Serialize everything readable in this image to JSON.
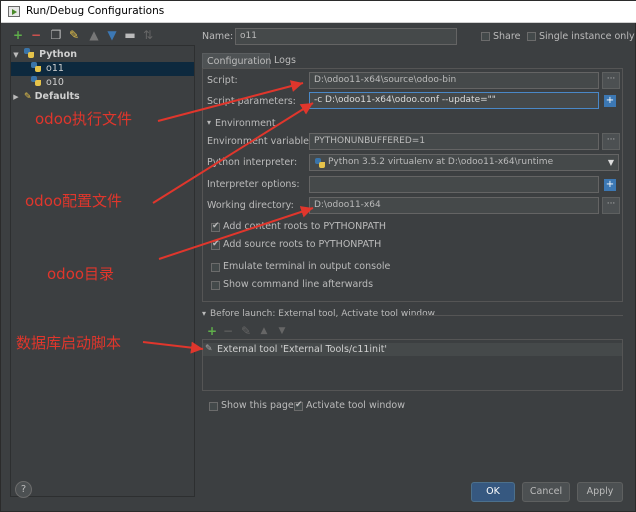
{
  "window": {
    "title": "Run/Debug Configurations"
  },
  "left_panel": {
    "toolbar_icons": [
      "add-icon",
      "remove-icon",
      "copy-icon",
      "wrench-icon",
      "move-up-icon",
      "move-down-icon",
      "folder-icon",
      "sort-icon"
    ],
    "tree": [
      {
        "label": "Python",
        "level": 0,
        "expanded": true
      },
      {
        "label": "o11",
        "level": 1,
        "selected": true
      },
      {
        "label": "o10",
        "level": 1
      },
      {
        "label": "Defaults",
        "level": 0,
        "expanded": false
      }
    ]
  },
  "header": {
    "name_label": "Name:",
    "name_value": "o11",
    "share_label": "Share",
    "single_instance_label": "Single instance only"
  },
  "tabs": [
    "Configuration",
    "Logs"
  ],
  "config": {
    "script_label": "Script:",
    "script_value": "D:\\odoo11-x64\\source\\odoo-bin",
    "params_label": "Script parameters:",
    "params_value": "-c D:\\odoo11-x64\\odoo.conf --update=\"\"",
    "environment_header": "Environment",
    "env_vars_label": "Environment variables:",
    "env_vars_value": "PYTHONUNBUFFERED=1",
    "interpreter_label": "Python interpreter:",
    "interpreter_value": "Python 3.5.2 virtualenv at D:\\odoo11-x64\\runtime",
    "interp_options_label": "Interpreter options:",
    "interp_options_value": "",
    "workdir_label": "Working directory:",
    "workdir_value": "D:\\odoo11-x64",
    "add_content_roots": "Add content roots to PYTHONPATH",
    "add_source_roots": "Add source roots to PYTHONPATH",
    "emulate_terminal": "Emulate terminal in output console",
    "show_command_line": "Show command line afterwards"
  },
  "before_launch": {
    "header": "Before launch: External tool, Activate tool window",
    "item": "External tool 'External Tools/c11init'",
    "show_page": "Show this page",
    "activate_window": "Activate tool window"
  },
  "buttons": {
    "ok": "OK",
    "cancel": "Cancel",
    "apply": "Apply",
    "help": "?"
  },
  "annotations": {
    "exec_file": "odoo执行文件",
    "config_file": "odoo配置文件",
    "directory": "odoo目录",
    "db_script": "数据库启动脚本"
  },
  "colors": {
    "annotation": "#e0362c",
    "accent": "#365880",
    "background": "#3c3f41"
  }
}
